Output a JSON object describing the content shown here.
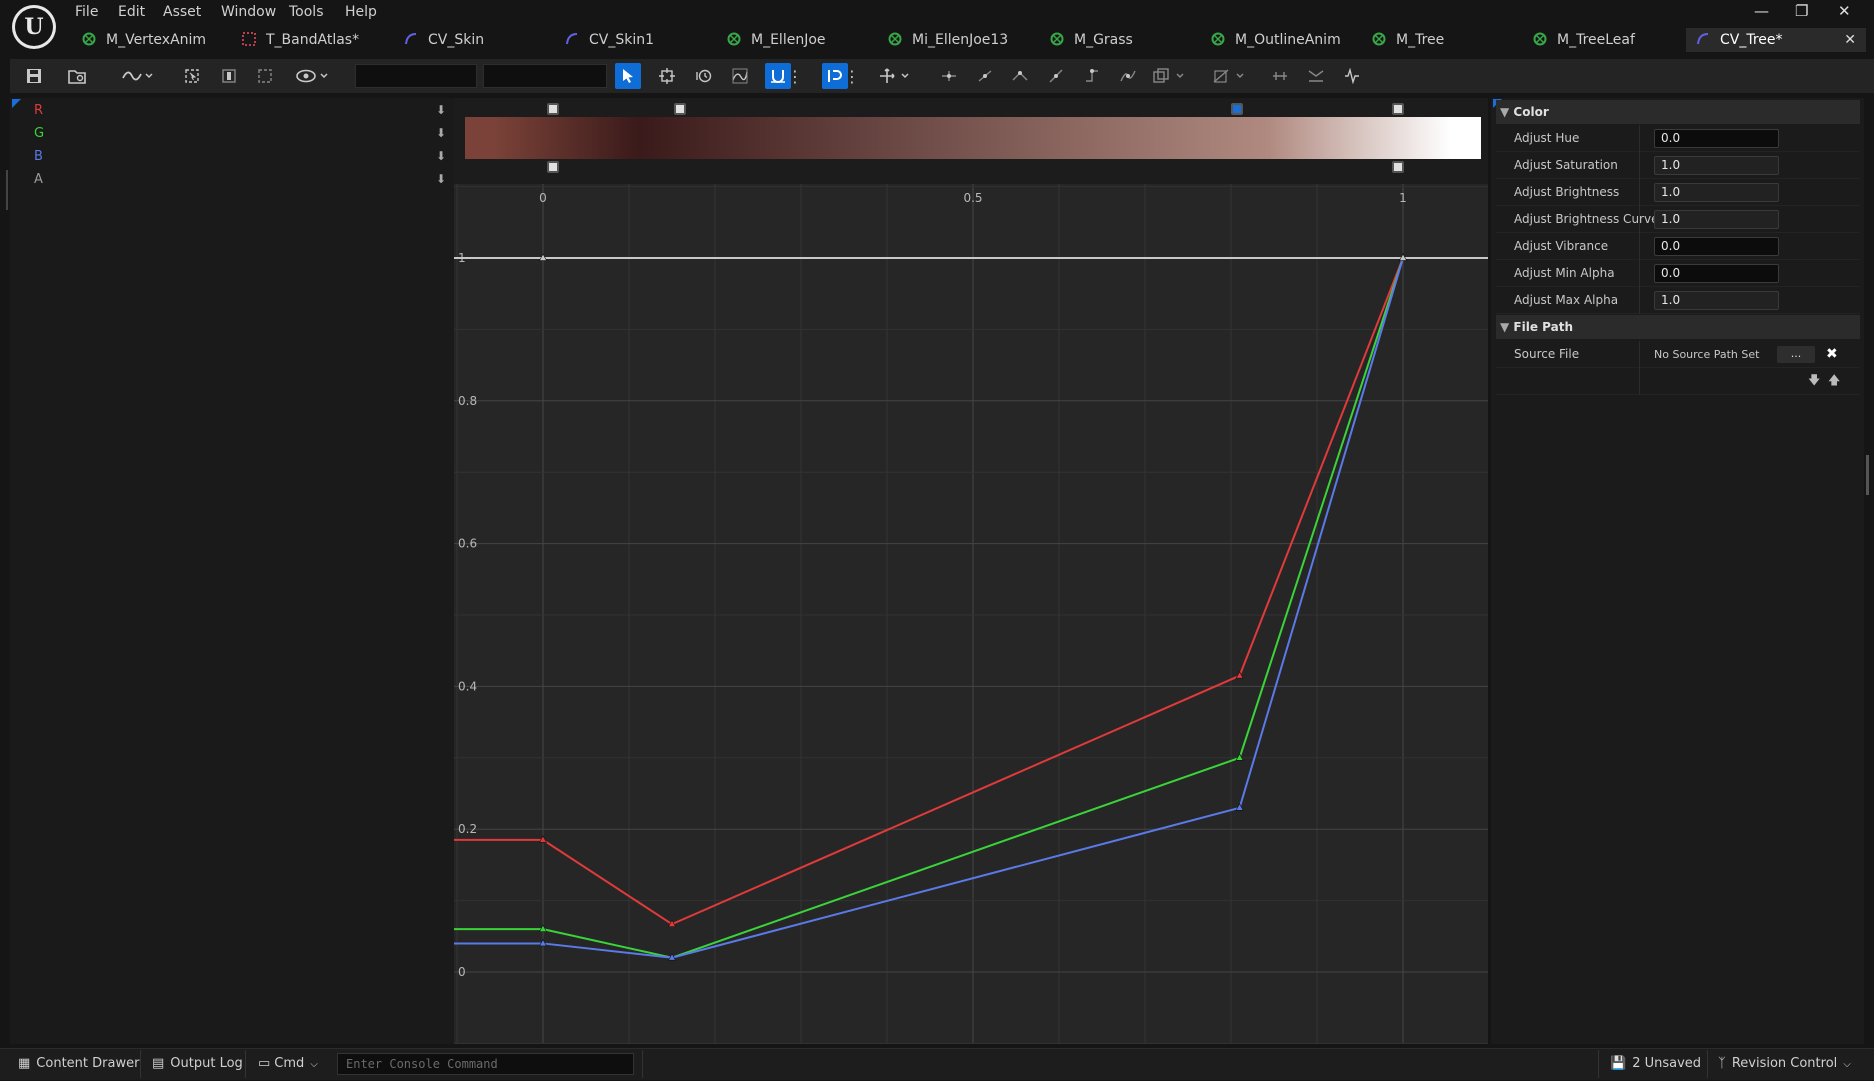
{
  "menu": {
    "items": [
      "File",
      "Edit",
      "Asset",
      "Window",
      "Tools",
      "Help"
    ]
  },
  "tabs": [
    {
      "label": "M_VertexAnim",
      "icon": "material-icon",
      "color": "#37a847"
    },
    {
      "label": "T_BandAtlas*",
      "icon": "texture-icon",
      "color": "#b8404a"
    },
    {
      "label": "CV_Skin",
      "icon": "curve-icon",
      "color": "#6060e0"
    },
    {
      "label": "CV_Skin1",
      "icon": "curve-icon",
      "color": "#6060e0"
    },
    {
      "label": "M_EllenJoe",
      "icon": "material-icon",
      "color": "#37a847"
    },
    {
      "label": "Mi_EllenJoe13",
      "icon": "material-instance-icon",
      "color": "#37a847"
    },
    {
      "label": "M_Grass",
      "icon": "material-icon",
      "color": "#37a847"
    },
    {
      "label": "M_OutlineAnim",
      "icon": "material-icon",
      "color": "#37a847"
    },
    {
      "label": "M_Tree",
      "icon": "material-icon",
      "color": "#37a847"
    },
    {
      "label": "M_TreeLeaf",
      "icon": "material-icon",
      "color": "#37a847"
    },
    {
      "label": "CV_Tree*",
      "icon": "curve-icon",
      "color": "#6060e0"
    }
  ],
  "channels": [
    {
      "label": "R",
      "color": "#e03a3a"
    },
    {
      "label": "G",
      "color": "#3ad43a"
    },
    {
      "label": "B",
      "color": "#5a7ae8"
    },
    {
      "label": "A",
      "color": "#9a9a9a"
    }
  ],
  "details": {
    "color_section": "Color",
    "color_props": [
      {
        "label": "Adjust Hue",
        "value": "0.0",
        "style": "dark"
      },
      {
        "label": "Adjust Saturation",
        "value": "1.0",
        "style": "grey"
      },
      {
        "label": "Adjust Brightness",
        "value": "1.0",
        "style": "grey"
      },
      {
        "label": "Adjust Brightness Curve",
        "value": "1.0",
        "style": "grey"
      },
      {
        "label": "Adjust Vibrance",
        "value": "0.0",
        "style": "dark"
      },
      {
        "label": "Adjust Min Alpha",
        "value": "0.0",
        "style": "dark"
      },
      {
        "label": "Adjust Max Alpha",
        "value": "1.0",
        "style": "grey"
      }
    ],
    "file_section": "File Path",
    "source_file_label": "Source File",
    "source_file_value": "No Source Path Set",
    "browse_label": "..."
  },
  "status": {
    "content_drawer": "Content Drawer",
    "output_log": "Output Log",
    "cmd": "Cmd",
    "console_placeholder": "Enter Console Command",
    "unsaved": "2 Unsaved",
    "revision": "Revision Control"
  },
  "chart_data": {
    "type": "line",
    "x_ticks": [
      "0",
      "0.5",
      "1"
    ],
    "y_ticks": [
      "0",
      "0.2",
      "0.4",
      "0.6",
      "0.8",
      "1"
    ],
    "xlim": [
      -0.1,
      1.1
    ],
    "ylim": [
      -0.1,
      1.0
    ],
    "grid": true,
    "series": [
      {
        "name": "R",
        "color": "#e03a3a",
        "x": [
          0.0,
          0.15,
          0.81,
          1.0
        ],
        "y": [
          0.185,
          0.067,
          0.415,
          1.0
        ]
      },
      {
        "name": "G",
        "color": "#3ad43a",
        "x": [
          0.0,
          0.15,
          0.81,
          1.0
        ],
        "y": [
          0.06,
          0.02,
          0.3,
          1.0
        ]
      },
      {
        "name": "B",
        "color": "#5a7ae8",
        "x": [
          0.0,
          0.15,
          0.81,
          1.0
        ],
        "y": [
          0.04,
          0.02,
          0.23,
          1.0
        ]
      },
      {
        "name": "A",
        "color": "#c8c8c8",
        "x": [
          0.0,
          1.0
        ],
        "y": [
          1.0,
          1.0
        ]
      }
    ],
    "gradient_stops": [
      {
        "pos": 0.0,
        "color": "#7a4238"
      },
      {
        "pos": 0.15,
        "color": "#3a1a1a"
      },
      {
        "pos": 0.81,
        "color": "#b08a80"
      },
      {
        "pos": 1.0,
        "color": "#ffffff"
      }
    ]
  }
}
